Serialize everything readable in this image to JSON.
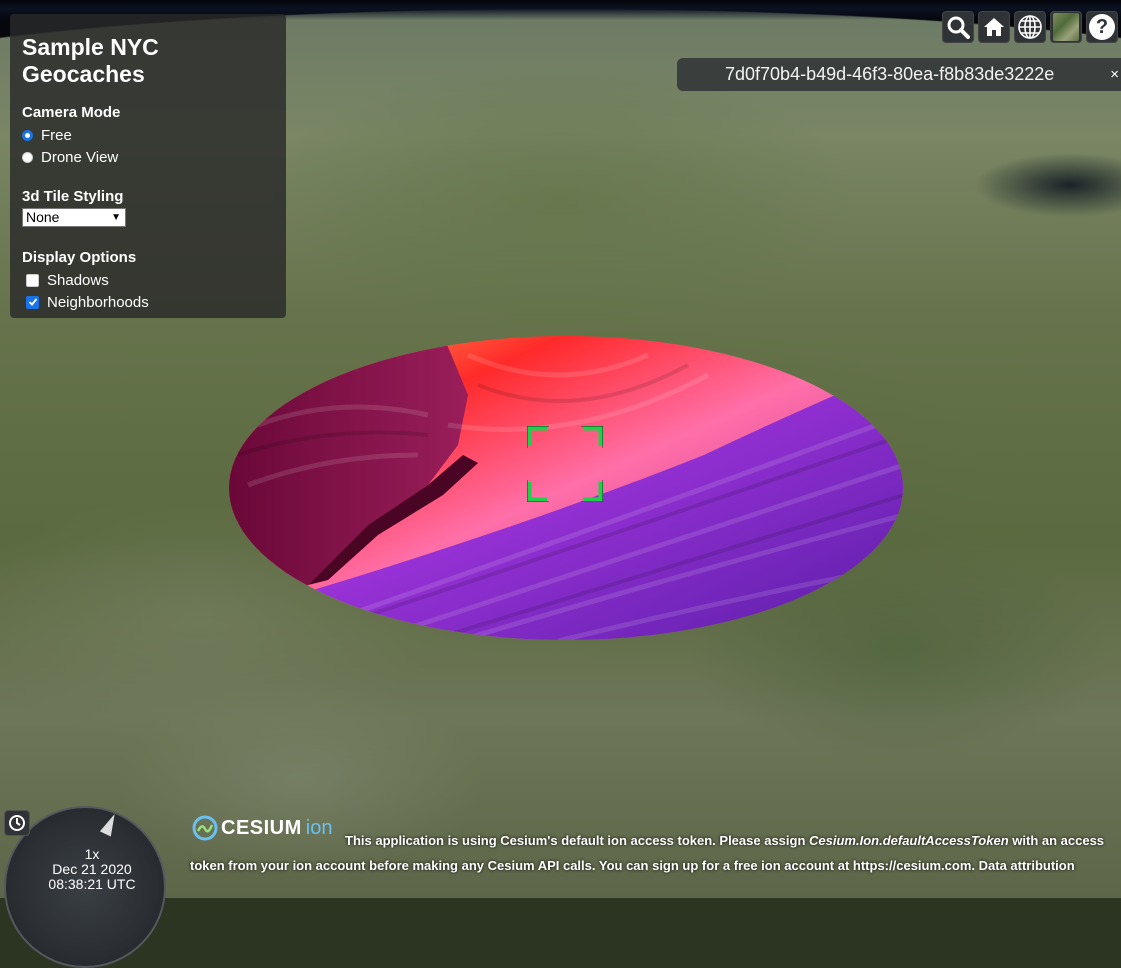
{
  "panel": {
    "title": "Sample NYC Geocaches",
    "camera_mode": {
      "heading": "Camera Mode",
      "options": [
        {
          "label": "Free",
          "selected": true
        },
        {
          "label": "Drone View",
          "selected": false
        }
      ]
    },
    "tile_styling": {
      "heading": "3d Tile Styling",
      "selected": "None"
    },
    "display_options": {
      "heading": "Display Options",
      "options": [
        {
          "label": "Shadows",
          "checked": false
        },
        {
          "label": "Neighborhoods",
          "checked": true
        }
      ]
    }
  },
  "toolbar": {
    "icons": [
      "search-icon",
      "home-icon",
      "globe-icon",
      "imagery-icon",
      "help-icon"
    ],
    "help_label": "?"
  },
  "token_banner": {
    "text": "7d0f70b4-b49d-46f3-80ea-f8b83de3222e",
    "close": "×"
  },
  "animation": {
    "speed": "1x",
    "date": "Dec 21 2020",
    "time": "08:38:21 UTC"
  },
  "credits": {
    "logo_text": "CESIUM",
    "logo_suffix": "ion",
    "message_prefix": "This application is using Cesium's default ion access token. Please assign ",
    "token_var": "Cesium.Ion.defaultAccessToken",
    "message_mid": " with an access token from your ion account before making any Cesium API calls. You can sign up for a free ion account at ",
    "link": "https://cesium.com",
    "message_end": ".",
    "data_attribution": "Data attribution"
  },
  "colors": {
    "accent": "#1a73e8",
    "reticle": "#1fd14a"
  }
}
